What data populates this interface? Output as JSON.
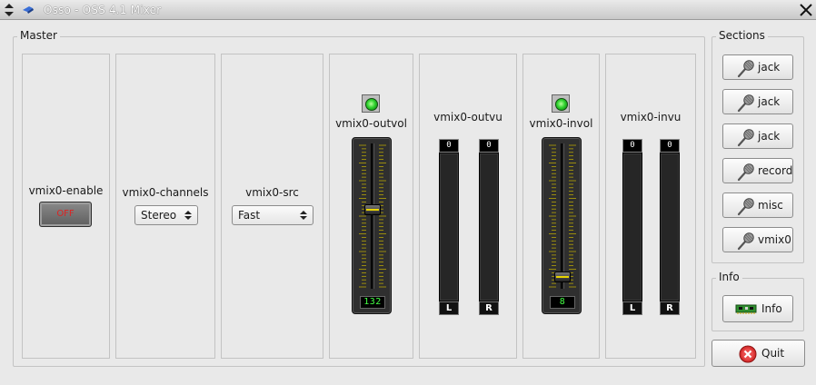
{
  "window": {
    "title": "Osso - OSS 4.1 Mixer"
  },
  "master": {
    "title": "Master",
    "controls": [
      {
        "label": "vmix0-enable",
        "type": "toggle",
        "value": "OFF"
      },
      {
        "label": "vmix0-channels",
        "type": "select",
        "value": "Stereo"
      },
      {
        "label": "vmix0-src",
        "type": "select",
        "value": "Fast"
      },
      {
        "label": "vmix0-outvol",
        "type": "slider",
        "readout": "132",
        "level": 0.55,
        "mute_led": "on"
      },
      {
        "label": "vmix0-outvu",
        "type": "vu",
        "left_peak": "0",
        "right_peak": "0",
        "left_label": "L",
        "right_label": "R"
      },
      {
        "label": "vmix0-invol",
        "type": "slider",
        "readout": "8",
        "level": 0.05,
        "mute_led": "on"
      },
      {
        "label": "vmix0-invu",
        "type": "vu",
        "left_peak": "0",
        "right_peak": "0",
        "left_label": "L",
        "right_label": "R"
      }
    ]
  },
  "sections": {
    "title": "Sections",
    "items": [
      {
        "label": "jack",
        "icon": "microphone-icon"
      },
      {
        "label": "jack",
        "icon": "microphone-icon"
      },
      {
        "label": "jack",
        "icon": "microphone-icon"
      },
      {
        "label": "record",
        "icon": "microphone-icon"
      },
      {
        "label": "misc",
        "icon": "microphone-icon"
      },
      {
        "label": "vmix0",
        "icon": "microphone-icon"
      }
    ]
  },
  "info": {
    "title": "Info",
    "button_label": "Info",
    "icon": "sound-card-icon"
  },
  "quit": {
    "label": "Quit",
    "icon": "quit-icon"
  },
  "colors": {
    "led_on": "#2fd32f",
    "readout": "#44ff44",
    "off_text": "#dd2222",
    "knob_line": "#e8d400"
  }
}
